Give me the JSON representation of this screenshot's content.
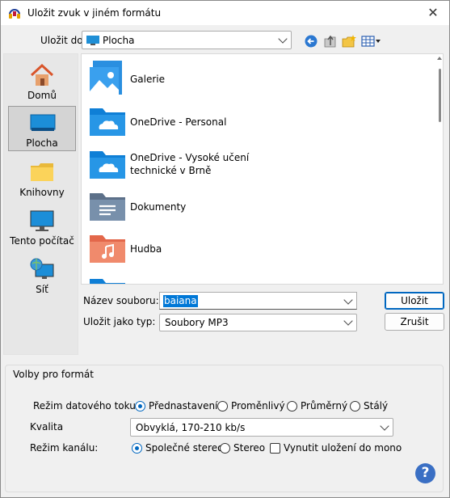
{
  "window": {
    "title": "Uložit zvuk v jiném formátu",
    "close_glyph": "✕"
  },
  "toolbar": {
    "save_in_label": "Uložit do:",
    "save_in_value": "Plocha",
    "icons": [
      "back-icon",
      "up-folder-icon",
      "new-folder-icon",
      "view-menu-icon"
    ]
  },
  "places": [
    {
      "label": "Domů",
      "icon": "home-icon"
    },
    {
      "label": "Plocha",
      "icon": "desktop-icon",
      "selected": true
    },
    {
      "label": "Knihovny",
      "icon": "libraries-icon"
    },
    {
      "label": "Tento počítač",
      "icon": "this-pc-icon"
    },
    {
      "label": "Síť",
      "icon": "network-icon"
    }
  ],
  "files": [
    {
      "label": "Galerie",
      "icon": "gallery-icon"
    },
    {
      "label": "OneDrive - Personal",
      "icon": "onedrive-folder-icon"
    },
    {
      "label": "OneDrive - Vysoké učení technické v Brně",
      "label_line1": "OneDrive - Vysoké učení",
      "label_line2": "technické v Brně",
      "icon": "onedrive-folder-icon"
    },
    {
      "label": "Dokumenty",
      "icon": "documents-folder-icon"
    },
    {
      "label": "Hudba",
      "icon": "music-folder-icon"
    }
  ],
  "form": {
    "filename_label": "Název souboru:",
    "filename_value": "baiana",
    "filetype_label": "Uložit jako typ:",
    "filetype_value": "Soubory MP3",
    "save_button": "Uložit",
    "cancel_button": "Zrušit"
  },
  "options": {
    "group_title": "Volby pro formát",
    "bitrate_mode_label": "Režim datového toku:",
    "bitrate_modes": [
      "Přednastavení",
      "Proměnlivý",
      "Průměrný",
      "Stálý"
    ],
    "bitrate_mode_selected": "Přednastavení",
    "quality_label": "Kvalita",
    "quality_value": "Obvyklá, 170-210 kb/s",
    "channel_mode_label": "Režim kanálu:",
    "channel_modes": [
      "Společné stereo",
      "Stereo"
    ],
    "channel_mode_selected": "Společné stereo",
    "force_mono_label": "Vynutit uložení do mono",
    "force_mono_checked": false,
    "help_glyph": "?"
  },
  "colors": {
    "accent": "#0067c0",
    "selection": "#0078d7"
  }
}
